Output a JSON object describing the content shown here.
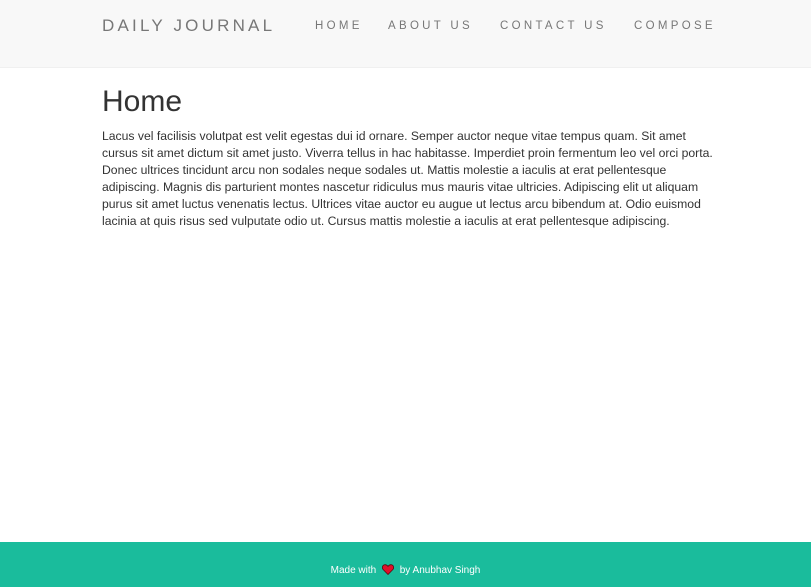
{
  "navbar": {
    "brand": "DAILY JOURNAL",
    "links": [
      {
        "label": "HOME"
      },
      {
        "label": "ABOUT US"
      },
      {
        "label": "CONTACT US"
      },
      {
        "label": "COMPOSE"
      }
    ]
  },
  "main": {
    "title": "Home",
    "body": "Lacus vel facilisis volutpat est velit egestas dui id ornare. Semper auctor neque vitae tempus quam. Sit amet cursus sit amet dictum sit amet justo. Viverra tellus in hac habitasse. Imperdiet proin fermentum leo vel orci porta. Donec ultrices tincidunt arcu non sodales neque sodales ut. Mattis molestie a iaculis at erat pellentesque adipiscing. Magnis dis parturient montes nascetur ridiculus mus mauris vitae ultricies. Adipiscing elit ut aliquam purus sit amet luctus venenatis lectus. Ultrices vitae auctor eu augue ut lectus arcu bibendum at. Odio euismod lacinia at quis risus sed vulputate odio ut. Cursus mattis molestie a iaculis at erat pellentesque adipiscing."
  },
  "footer": {
    "prefix": "Made with",
    "icon": "heart-icon",
    "suffix": "by Anubhav Singh"
  },
  "colors": {
    "navbar_bg": "#f8f8f8",
    "footer_bg": "#1abc9c",
    "nav_text": "#777777",
    "body_text": "#333333",
    "heart": "#e0102a"
  }
}
